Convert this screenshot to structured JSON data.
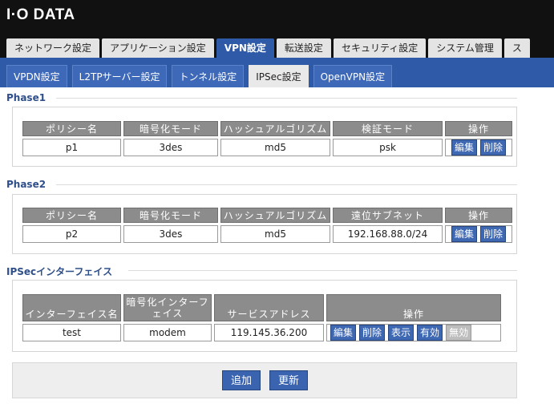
{
  "brand": {
    "logo_text": "I·O DATA"
  },
  "main_tabs": [
    {
      "label": "ネットワーク設定"
    },
    {
      "label": "アプリケーション設定"
    },
    {
      "label": "VPN設定"
    },
    {
      "label": "転送設定"
    },
    {
      "label": "セキュリティ設定"
    },
    {
      "label": "システム管理"
    },
    {
      "label": "ス"
    }
  ],
  "sub_tabs": [
    {
      "label": "VPDN設定"
    },
    {
      "label": "L2TPサーバー設定"
    },
    {
      "label": "トンネル設定"
    },
    {
      "label": "IPSec設定"
    },
    {
      "label": "OpenVPN設定"
    }
  ],
  "phase1": {
    "title": "Phase1",
    "headers": [
      "ポリシー名",
      "暗号化モード",
      "ハッシュアルゴリズム",
      "検証モード",
      "操作"
    ],
    "row": {
      "name": "p1",
      "encryption": "3des",
      "hash": "md5",
      "verify": "psk"
    },
    "actions": [
      "編集",
      "削除"
    ]
  },
  "phase2": {
    "title": "Phase2",
    "headers": [
      "ポリシー名",
      "暗号化モード",
      "ハッシュアルゴリズム",
      "遠位サブネット",
      "操作"
    ],
    "row": {
      "name": "p2",
      "encryption": "3des",
      "hash": "md5",
      "subnet": "192.168.88.0/24"
    },
    "actions": [
      "編集",
      "削除"
    ]
  },
  "interface": {
    "title": "IPSecインターフェイス",
    "headers": [
      "インターフェイス名",
      "暗号化インターフェイス",
      "サービスアドレス",
      "操作"
    ],
    "row": {
      "name": "test",
      "iface": "modem",
      "address": "119.145.36.200"
    },
    "actions": [
      "編集",
      "削除",
      "表示",
      "有効",
      "無効"
    ]
  },
  "footer": {
    "add": "追加",
    "update": "更新"
  },
  "colors": {
    "accent": "#2f5aa8",
    "header_bg": "#111111",
    "table_header": "#8c8c8c"
  }
}
